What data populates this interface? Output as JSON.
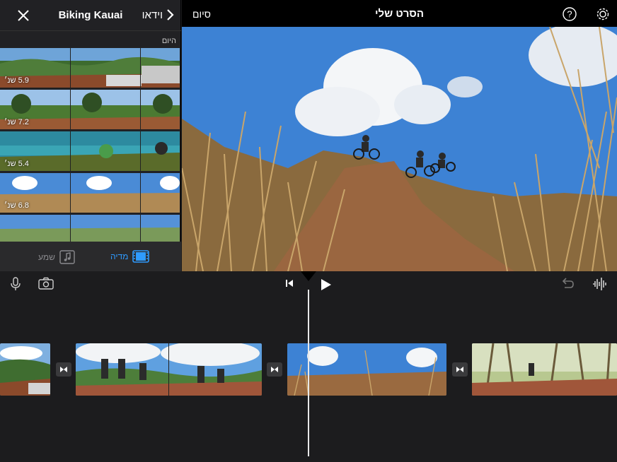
{
  "browser": {
    "title": "Biking Kauai",
    "back_label": "וידאו",
    "section_label": "היום",
    "clips": [
      {
        "duration": "5.9 שנ׳"
      },
      {
        "duration": "7.2 שנ׳"
      },
      {
        "duration": "5.4 שנ׳"
      },
      {
        "duration": "6.8 שנ׳"
      },
      {
        "duration": ""
      }
    ],
    "tabs": {
      "media": "מדיה",
      "audio": "שמע"
    }
  },
  "topbar": {
    "title": "הסרט שלי",
    "done_label": "סיום"
  },
  "icons": [
    "close-icon",
    "chevron-left-icon",
    "film-icon",
    "music-note-icon",
    "help-icon",
    "gear-icon",
    "microphone-icon",
    "camera-icon",
    "skip-back-icon",
    "play-icon",
    "undo-icon",
    "waveform-icon",
    "transition-icon"
  ],
  "colors": {
    "accent": "#2f9bff",
    "background": "#1c1c1e",
    "panel": "#212124"
  }
}
